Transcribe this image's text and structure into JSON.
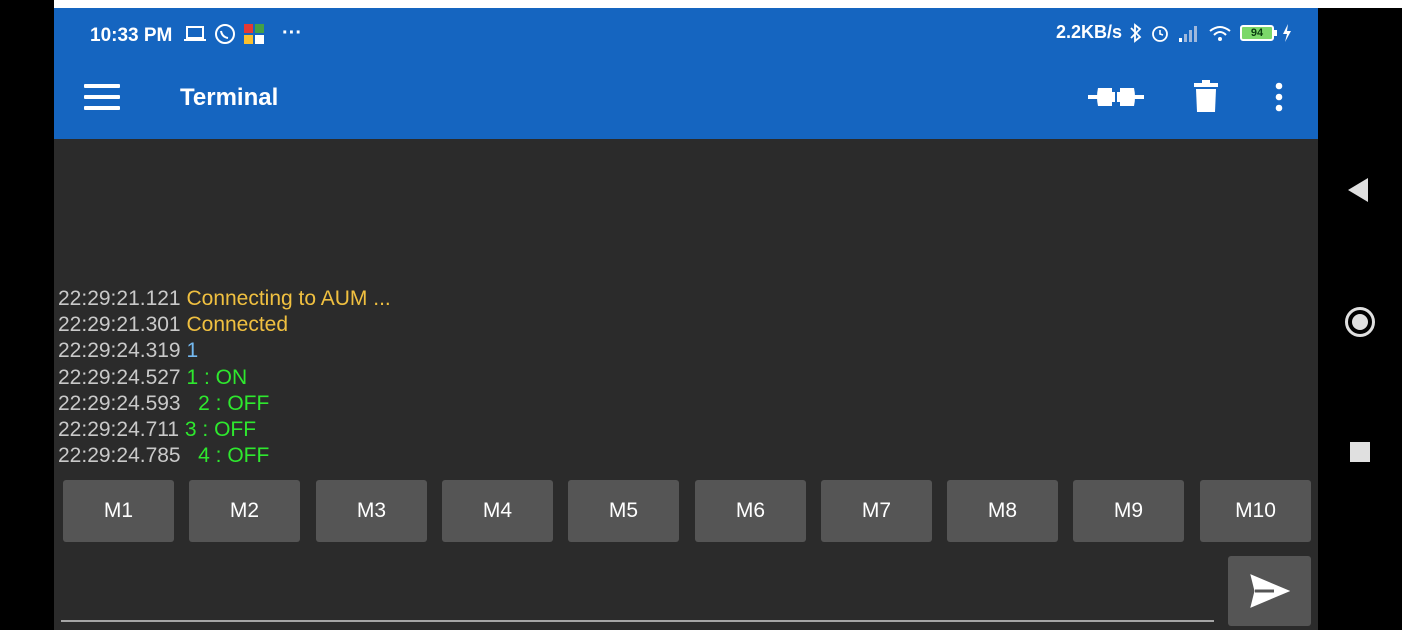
{
  "status_bar": {
    "time": "10:33 PM",
    "more": "···",
    "net_speed": "2.2KB/s",
    "battery": "94"
  },
  "toolbar": {
    "title": "Terminal"
  },
  "terminal": {
    "lines": [
      {
        "ts": "22:29:21.121",
        "text": "Connecting to AUM ...",
        "color": "#f0c040"
      },
      {
        "ts": "22:29:21.301",
        "text": "Connected",
        "color": "#f0c040"
      },
      {
        "ts": "22:29:24.319",
        "text": "1",
        "color": "#74b9f0"
      },
      {
        "ts": "22:29:24.527",
        "text": "1 : ON",
        "color": "#2ee82e"
      },
      {
        "ts": "22:29:24.593",
        "text": "  2 : OFF",
        "color": "#2ee82e"
      },
      {
        "ts": "22:29:24.711",
        "text": "3 : OFF",
        "color": "#2ee82e"
      },
      {
        "ts": "22:29:24.785",
        "text": "  4 : OFF",
        "color": "#2ee82e"
      }
    ]
  },
  "macros": [
    "M1",
    "M2",
    "M3",
    "M4",
    "M5",
    "M6",
    "M7",
    "M8",
    "M9",
    "M10"
  ],
  "input": {
    "value": "",
    "placeholder": ""
  },
  "colors": {
    "toolbar_bg": "#1565c0",
    "screen_bg": "#2b2b2b",
    "button_bg": "#555555",
    "timestamp": "#c9c9c9"
  }
}
